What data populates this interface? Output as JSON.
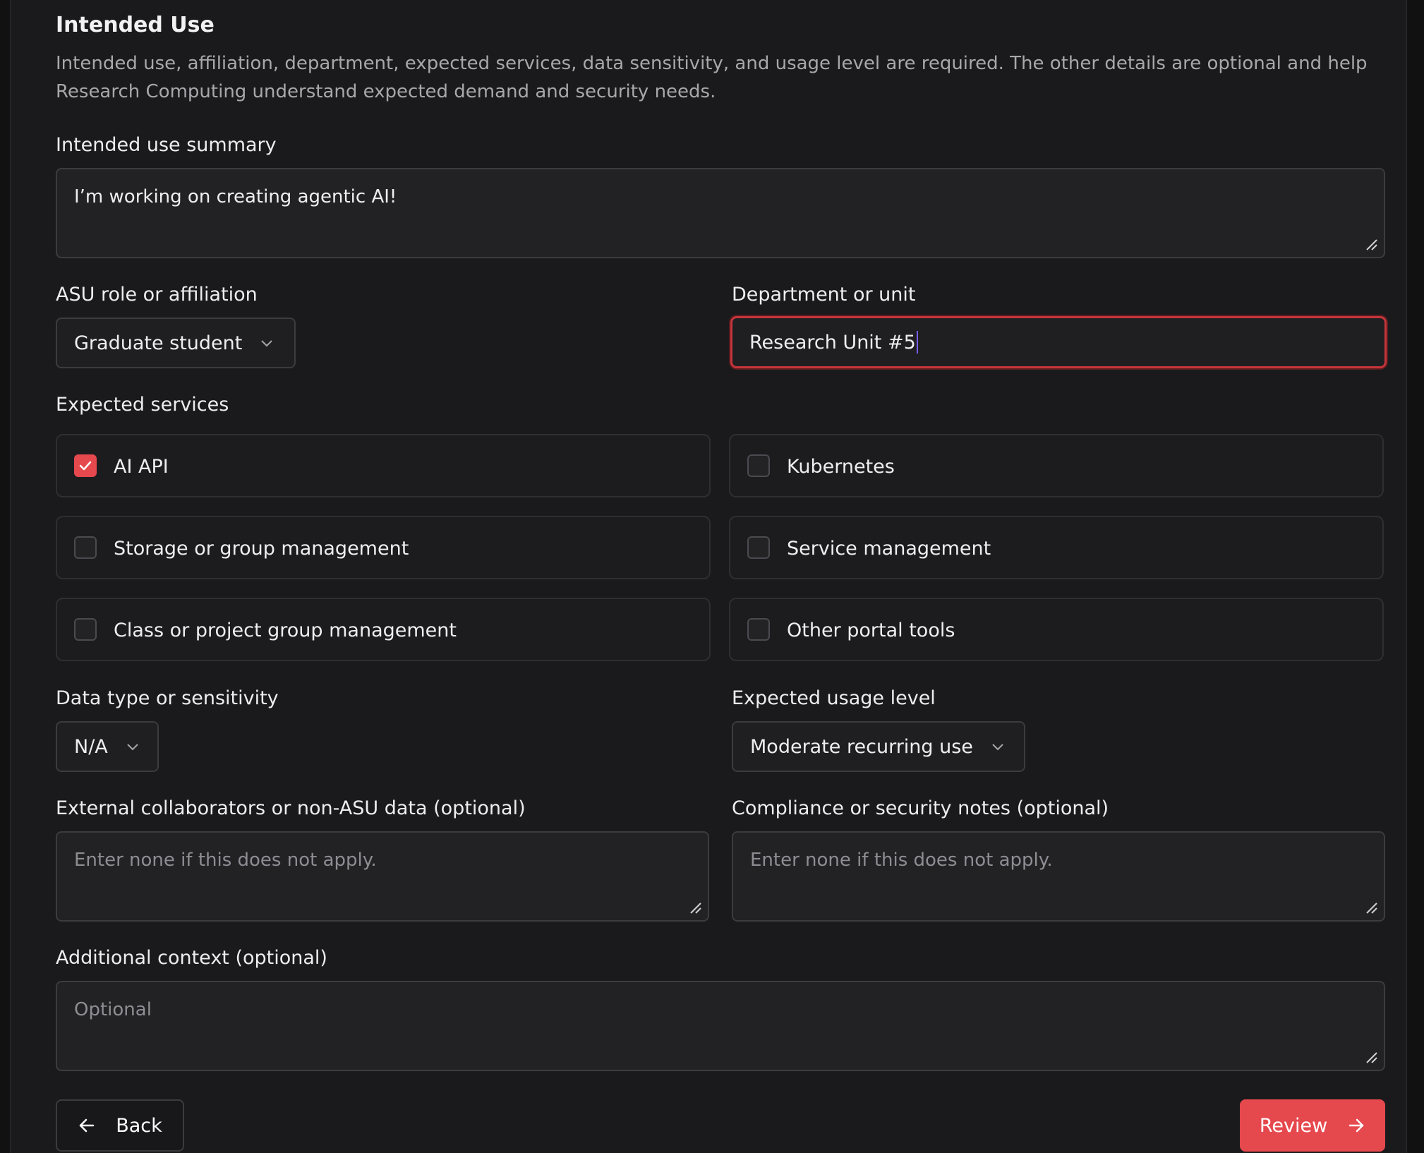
{
  "section": {
    "title": "Intended Use",
    "description": "Intended use, affiliation, department, expected services, data sensitivity, and usage level are required. The other details are optional and help Research Computing understand expected demand and security needs."
  },
  "intended_use": {
    "label": "Intended use summary",
    "value": "I’m working on creating agentic AI!"
  },
  "affiliation": {
    "label": "ASU role or affiliation",
    "selected": "Graduate student"
  },
  "department": {
    "label": "Department or unit",
    "value": "Research Unit #5"
  },
  "services": {
    "label": "Expected services",
    "items": [
      {
        "label": "AI API",
        "checked": true
      },
      {
        "label": "Kubernetes",
        "checked": false
      },
      {
        "label": "Storage or group management",
        "checked": false
      },
      {
        "label": "Service management",
        "checked": false
      },
      {
        "label": "Class or project group management",
        "checked": false
      },
      {
        "label": "Other portal tools",
        "checked": false
      }
    ]
  },
  "data_sensitivity": {
    "label": "Data type or sensitivity",
    "selected": "N/A"
  },
  "usage_level": {
    "label": "Expected usage level",
    "selected": "Moderate recurring use"
  },
  "external": {
    "label": "External collaborators or non-ASU data (optional)",
    "placeholder": "Enter none if this does not apply."
  },
  "compliance": {
    "label": "Compliance or security notes (optional)",
    "placeholder": "Enter none if this does not apply."
  },
  "additional": {
    "label": "Additional context (optional)",
    "placeholder": "Optional"
  },
  "actions": {
    "back_label": "Back",
    "review_label": "Review"
  },
  "icons": {
    "back": "arrow-left-icon",
    "review": "arrow-right-icon",
    "dropdown": "chevron-down-icon",
    "check": "check-icon",
    "resize": "resize-grip-icon"
  },
  "colors": {
    "accent": "#e5484d",
    "background": "#1a1a1c",
    "field": "#222225",
    "caret": "#7b5cff"
  }
}
